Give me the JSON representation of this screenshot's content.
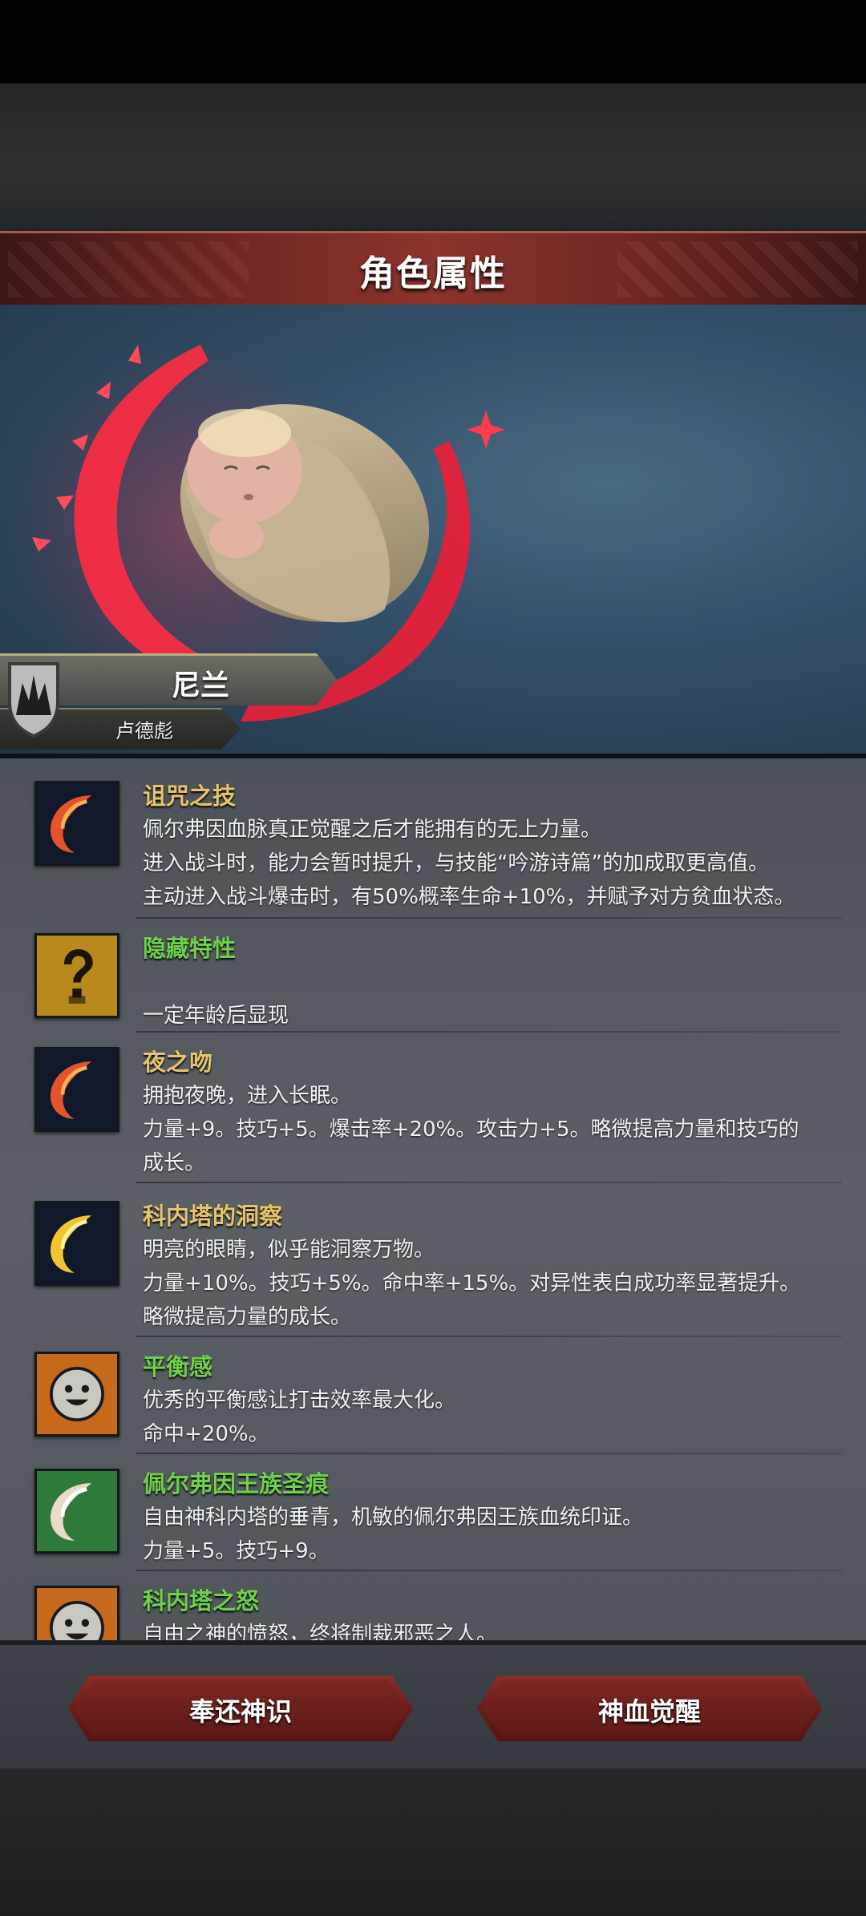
{
  "header": {
    "title": "角色属性"
  },
  "character": {
    "name": "尼兰",
    "title": "卢德彪"
  },
  "traits": [
    {
      "name": "诅咒之技",
      "name_color": "#e6c46a",
      "icon": "red-crescent-icon",
      "lines": [
        "佩尔弗因血脉真正觉醒之后才能拥有的无上力量。",
        "进入战斗时，能力会暂时提升，与技能“吟游诗篇”的加成取更高值。",
        "主动进入战斗爆击时，有50%概率生命+10%，并赋予对方贫血状态。"
      ]
    },
    {
      "name": "隐藏特性",
      "name_color": "#6fd04a",
      "icon": "question-mark-icon",
      "lines": [
        "",
        "一定年龄后显现"
      ]
    },
    {
      "name": "夜之吻",
      "name_color": "#e6c46a",
      "icon": "red-crescent-icon",
      "lines": [
        "拥抱夜晚，进入长眠。",
        "力量+9。技巧+5。爆击率+20%。攻击力+5。略微提高力量和技巧的",
        "成长。"
      ]
    },
    {
      "name": "科内塔的洞察",
      "name_color": "#e6c46a",
      "icon": "gold-crescent-icon",
      "lines": [
        "明亮的眼睛，似乎能洞察万物。",
        "力量+10%。技巧+5%。命中率+15%。对异性表白成功率显著提升。",
        "略微提高力量的成长。"
      ]
    },
    {
      "name": "平衡感",
      "name_color": "#6fd04a",
      "icon": "smile-face-icon",
      "lines": [
        "优秀的平衡感让打击效率最大化。",
        "命中+20%。"
      ]
    },
    {
      "name": "佩尔弗因王族圣痕",
      "name_color": "#6fd04a",
      "icon": "white-crescent-icon",
      "lines": [
        "自由神科内塔的垂青，机敏的佩尔弗因王族血统印证。",
        "力量+5。技巧+9。"
      ]
    },
    {
      "name": "科内塔之怒",
      "name_color": "#6fd04a",
      "icon": "smile-face-icon",
      "lines": [
        "自由之神的愤怒，终将制裁邪恶之人。"
      ]
    }
  ],
  "actions": {
    "left": "奉还神识",
    "right": "神血觉醒"
  },
  "colors": {
    "banner": "#8c342d",
    "gold": "#e6c46a",
    "green": "#6fd04a",
    "button": "#6a1c1a"
  }
}
